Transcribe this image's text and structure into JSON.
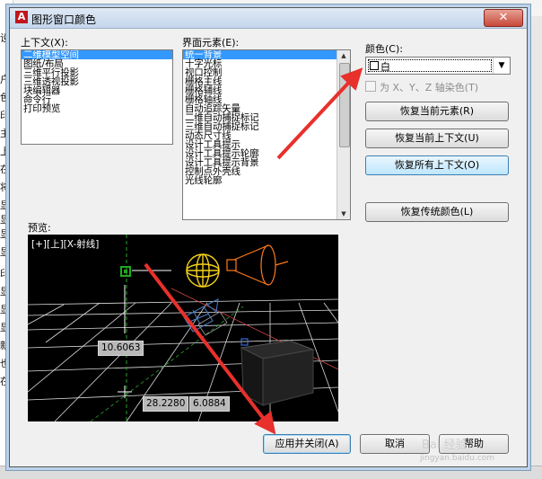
{
  "window": {
    "title": "图形窗口颜色",
    "close_glyph": "✕"
  },
  "context_section": {
    "label": "上下文(X):",
    "items": [
      "二维模型空间",
      "图纸/布局",
      "三维平行投影",
      "三维透视投影",
      "块编辑器",
      "命令行",
      "打印预览"
    ],
    "selected_index": 0
  },
  "elements_section": {
    "label": "界面元素(E):",
    "items": [
      "统一背景",
      "十字光标",
      "视口控制",
      "栅格主线",
      "栅格辅线",
      "栅格轴线",
      "自动追踪矢量",
      "二维自动捕捉标记",
      "三维自动捕捉标记",
      "动态尺寸线",
      "设计工具提示",
      "设计工具提示轮廓",
      "设计工具提示背景",
      "控制点外壳线",
      "光线轮廓"
    ],
    "selected_index": 0
  },
  "color_section": {
    "label": "颜色(C):",
    "value": "白",
    "dropdown_glyph": "▼",
    "tint_checkbox_label": "为 X、Y、Z 轴染色(T)",
    "tint_checked": false
  },
  "buttons": {
    "restore_element": "恢复当前元素(R)",
    "restore_context": "恢复当前上下文(U)",
    "restore_all": "恢复所有上下文(O)",
    "restore_classic": "恢复传统颜色(L)",
    "apply_close": "应用并关闭(A)",
    "cancel": "取消",
    "help": "帮助"
  },
  "preview": {
    "label": "预览:",
    "viewport_label": "[+][上][X-射线]",
    "readouts": [
      "10.6063",
      "28.2280",
      "6.0884"
    ]
  },
  "background_window": {
    "left_chars": [
      "设",
      "户",
      "色",
      "印",
      "主",
      "上",
      "在",
      "将",
      "显",
      "显",
      "显",
      "显",
      "印",
      "显",
      "显",
      "显",
      "新",
      "也",
      "在"
    ],
    "top_right": "a"
  },
  "watermark": {
    "top": "Bai 经验",
    "bottom": "jingyan.baidu.com"
  },
  "colors": {
    "selection": "#3399ff",
    "arrow": "#e8302c",
    "preview_bg": "#000000"
  }
}
